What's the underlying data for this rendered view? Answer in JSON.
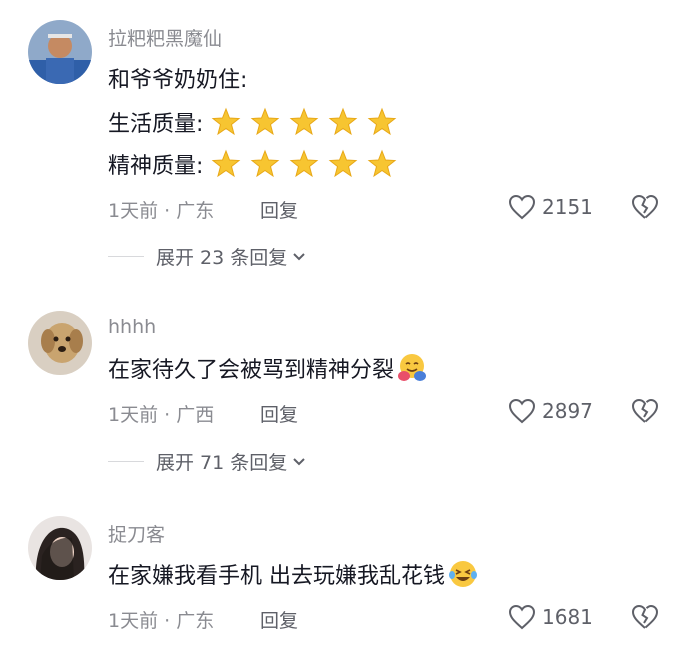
{
  "comments": [
    {
      "username": "拉粑粑黑魔仙",
      "lines": [
        "和爷爷奶奶住:",
        "生活质量:",
        "精神质量:"
      ],
      "stars_per_line": 5,
      "time_location": "1天前 · 广东",
      "reply_label": "回复",
      "likes": "2151",
      "expand_label": "展开 23 条回复"
    },
    {
      "username": "hhhh",
      "lines": [
        "在家待久了会被骂到精神分裂"
      ],
      "emoji": "hugging-face-emoji",
      "time_location": "1天前 · 广西",
      "reply_label": "回复",
      "likes": "2897",
      "expand_label": "展开 71 条回复"
    },
    {
      "username": "捉刀客",
      "lines": [
        "在家嫌我看手机 出去玩嫌我乱花钱"
      ],
      "emoji": "laughing-tears-emoji",
      "time_location": "1天前 · 广东",
      "reply_label": "回复",
      "likes": "1681"
    }
  ],
  "colors": {
    "text": "#161823",
    "meta": "#8a8b91",
    "star": "#f7c531"
  }
}
